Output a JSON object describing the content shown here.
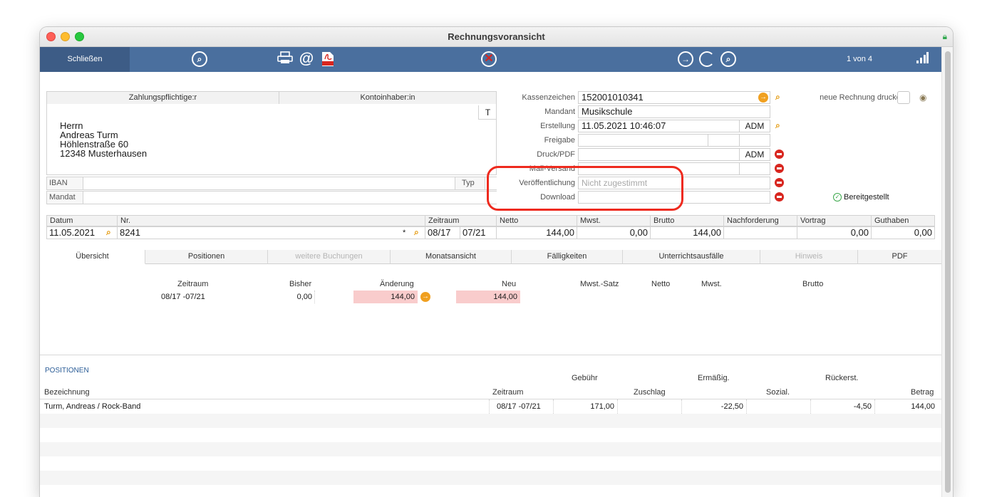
{
  "window": {
    "title": "Rechnungsvoransicht"
  },
  "toolbar": {
    "close_label": "Schließen",
    "page_counter": "1 von 4",
    "icons": [
      "search-circle-icon",
      "printer-icon",
      "at-icon",
      "pdf-icon",
      "no-entry-icon",
      "arrow-right-circle-icon",
      "refresh-icon",
      "search-circle-icon",
      "signal-icon"
    ]
  },
  "address": {
    "col_payer": "Zahlungspflichtige:r",
    "col_holder": "Kontoinhaber:in",
    "t_button": "T",
    "lines": [
      "Herrn",
      "Andreas Turm",
      "Höhlenstraße 60",
      "12348 Musterhausen"
    ],
    "iban_label": "IBAN",
    "type_label": "Typ",
    "mandate_label": "Mandat"
  },
  "details": {
    "kassenzeichen_label": "Kassenzeichen",
    "kassenzeichen_value": "152001010341",
    "mandant_label": "Mandant",
    "mandant_value": "Musikschule",
    "erstellung_label": "Erstellung",
    "erstellung_value": "11.05.2021 10:46:07",
    "erstellung_user": "ADM",
    "freigabe_label": "Freigabe",
    "druck_label": "Druck/PDF",
    "druck_user": "ADM",
    "mail_label": "Mail-Versand",
    "veroeff_label": "Veröffentlichung",
    "veroeff_placeholder": "Nicht zugestimmt",
    "download_label": "Download",
    "new_invoice_label": "neue Rechnung drucken",
    "provided_label": "Bereitgestellt"
  },
  "summary": {
    "headers": [
      "Datum",
      "Nr.",
      "Zeitraum",
      "Netto",
      "Mwst.",
      "Brutto",
      "Nachforderung",
      "Vortrag",
      "Guthaben"
    ],
    "datum": "11.05.2021",
    "nr": "8241",
    "nr_marker": "*",
    "zeitraum_from": "08/17",
    "zeitraum_to": "07/21",
    "netto": "144,00",
    "mwst": "0,00",
    "brutto": "144,00",
    "nachforderung": "",
    "vortrag": "0,00",
    "guthaben": "0,00"
  },
  "tabs": [
    {
      "label": "Übersicht",
      "state": "active"
    },
    {
      "label": "Positionen",
      "state": "normal"
    },
    {
      "label": "weitere Buchungen",
      "state": "disabled"
    },
    {
      "label": "Monatsansicht",
      "state": "normal"
    },
    {
      "label": "Fälligkeiten",
      "state": "normal"
    },
    {
      "label": "Unterrichtsausfälle",
      "state": "normal"
    },
    {
      "label": "Hinweis",
      "state": "disabled"
    },
    {
      "label": "PDF",
      "state": "normal"
    }
  ],
  "overview": {
    "headers": [
      "Zeitraum",
      "Bisher",
      "Änderung",
      "Neu",
      "Mwst.-Satz",
      "Netto",
      "Mwst.",
      "Brutto"
    ],
    "row": {
      "zeitraum": "08/17 -07/21",
      "bisher": "0,00",
      "aenderung": "144,00",
      "neu": "144,00"
    }
  },
  "positions": {
    "section_title": "POSITIONEN",
    "header_top": [
      "Gebühr",
      "Ermäßig.",
      "Rückerst."
    ],
    "header_bottom": [
      "Bezeichnung",
      "Zeitraum",
      "Zuschlag",
      "Sozial.",
      "Betrag"
    ],
    "rows": [
      {
        "bezeichnung": "Turm, Andreas / Rock-Band",
        "zeitraum": "08/17 -07/21",
        "gebuehr": "171,00",
        "zuschlag": "",
        "ermaessig": "-22,50",
        "sozial": "",
        "rueckerst": "-4,50",
        "betrag": "144,00"
      }
    ]
  },
  "colors": {
    "toolbar": "#4a6f9e",
    "close_button": "#3d5c86",
    "highlight": "#f9cccc",
    "accent_orange": "#f0a020",
    "delete_red": "#d8261f"
  }
}
